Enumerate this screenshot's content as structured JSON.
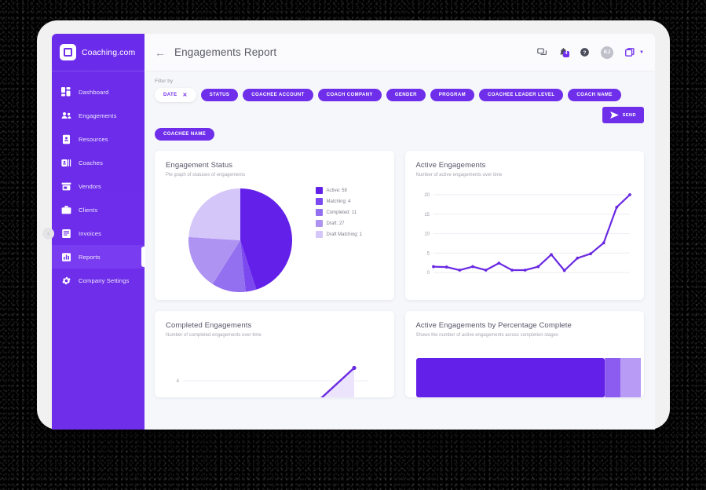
{
  "brand": {
    "name": "Coaching.com",
    "logo_icon": "square-logo-icon"
  },
  "sidebar": {
    "items": [
      {
        "label": "Dashboard",
        "icon": "grid-icon",
        "active": false
      },
      {
        "label": "Engagements",
        "icon": "people-icon",
        "active": false
      },
      {
        "label": "Resources",
        "icon": "book-icon",
        "active": false
      },
      {
        "label": "Coaches",
        "icon": "id-card-icon",
        "active": false
      },
      {
        "label": "Vendors",
        "icon": "store-icon",
        "active": false
      },
      {
        "label": "Clients",
        "icon": "briefcase-icon",
        "active": false
      },
      {
        "label": "Invoices",
        "icon": "document-icon",
        "active": false
      },
      {
        "label": "Reports",
        "icon": "bar-chart-icon",
        "active": true
      },
      {
        "label": "Company Settings",
        "icon": "gear-icon",
        "active": false
      }
    ]
  },
  "topbar": {
    "back_label": "←",
    "title": "Engagements Report",
    "icons": [
      {
        "name": "chat-icon"
      },
      {
        "name": "bell-icon",
        "badge": "4"
      },
      {
        "name": "help-icon"
      }
    ],
    "avatar_initials": "KJ",
    "app_switcher_icon": "app-square-icon",
    "caret_icon": "chevron-down-icon"
  },
  "filters": {
    "label": "Filter by",
    "active_chip": {
      "label": "DATE",
      "close_icon": "close-icon"
    },
    "chips": [
      "STATUS",
      "COACHEE ACCOUNT",
      "COACH COMPANY",
      "GENDER",
      "PROGRAM",
      "COACHEE LEADER LEVEL",
      "COACH NAME",
      "COACHEE NAME"
    ],
    "send_button": {
      "label": "SEND",
      "icon": "send-icon"
    }
  },
  "colors": {
    "brand_purple": "#6f2fea",
    "pie_1": "#6320e8",
    "pie_2": "#7b49ef",
    "pie_3": "#9370f0",
    "pie_4": "#ae93f3",
    "pie_5": "#d5c6f9"
  },
  "cards": {
    "engagement_status": {
      "title": "Engagement Status",
      "subtitle": "Pie graph of statuses of engagements"
    },
    "active_engagements": {
      "title": "Active Engagements",
      "subtitle": "Number of active engagements over time"
    },
    "completed_engagements": {
      "title": "Completed Engagements",
      "subtitle": "Number of completed engagements over time"
    },
    "percentage_complete": {
      "title": "Active Engagements by Percentage Complete",
      "subtitle": "Shows the number of active engagements across completion stages"
    }
  },
  "chart_data": [
    {
      "id": "engagement-status-pie",
      "type": "pie",
      "title": "Engagement Status",
      "subtitle": "Pie graph of statuses of engagements",
      "legend_position": "right",
      "labels": [
        "Active",
        "Matching",
        "Completed",
        "Draft",
        "Draft Matching"
      ],
      "values": [
        58,
        4,
        11,
        27,
        1
      ],
      "legend_entries": [
        "Active: 58",
        "Matching: 4",
        "Completed: 11",
        "Draft: 27",
        "Draft Matching: 1"
      ],
      "colors": [
        "#6320e8",
        "#7b49ef",
        "#9370f0",
        "#ae93f3",
        "#d5c6f9"
      ]
    },
    {
      "id": "active-engagements-line",
      "type": "line",
      "title": "Active Engagements",
      "subtitle": "Number of active engagements over time",
      "xlabel": "",
      "ylabel": "",
      "ylim": [
        0,
        20
      ],
      "yticks": [
        0,
        5,
        10,
        15,
        20
      ],
      "ytick_labels": [
        "0",
        "5",
        "10",
        "15",
        "20"
      ],
      "grid": true,
      "x": [
        1,
        2,
        3,
        4,
        5,
        6,
        7,
        8,
        9,
        10,
        11,
        12,
        13,
        14,
        15,
        16
      ],
      "values": [
        1.5,
        1.4,
        0.6,
        1.5,
        0.6,
        2.4,
        0.6,
        0.6,
        1.5,
        4.6,
        0.5,
        3.7,
        4.8,
        7.6,
        16.8,
        20
      ],
      "color": "#6929e2"
    },
    {
      "id": "completed-engagements-area",
      "type": "area",
      "title": "Completed Engagements",
      "subtitle": "Number of completed engagements over time",
      "ylim": [
        0,
        8
      ],
      "yticks": [
        4
      ],
      "ytick_labels": [
        "4"
      ],
      "grid": true,
      "x": [
        1,
        2,
        3
      ],
      "values": [
        0,
        0,
        6
      ],
      "color": "#6929e2",
      "fill": "#ece4fc"
    },
    {
      "id": "percentage-complete-bar",
      "type": "bar",
      "orientation": "horizontal",
      "stacked": true,
      "title": "Active Engagements by Percentage Complete",
      "subtitle": "Shows the number of active engagements across completion stages",
      "categories": [
        "stage-1",
        "stage-2",
        "stage-3"
      ],
      "values": [
        84,
        7,
        9
      ],
      "colors": [
        "#6320e8",
        "#8c5cf0",
        "#b79bf5"
      ]
    }
  ]
}
